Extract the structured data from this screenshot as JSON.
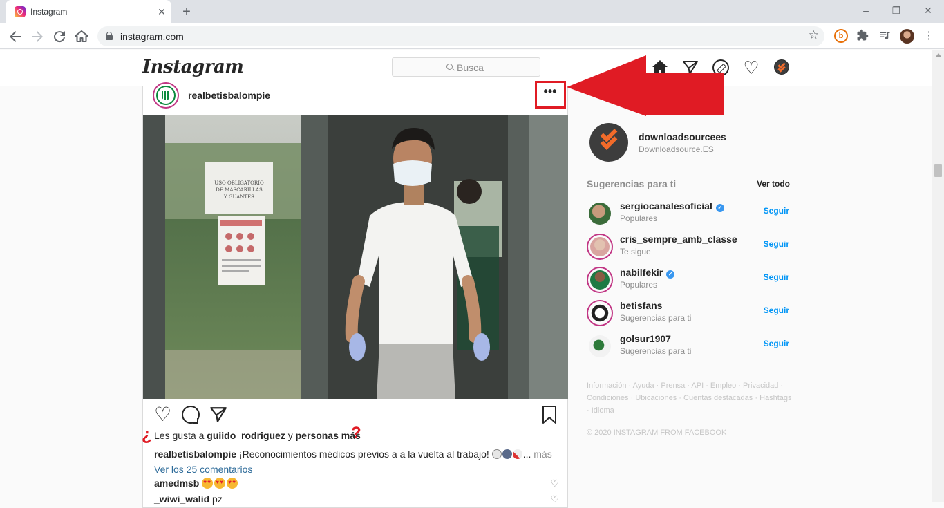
{
  "browser": {
    "tab_title": "Instagram",
    "tab_close": "✕",
    "new_tab": "+",
    "url": "instagram.com",
    "window_controls": [
      "–",
      "❐",
      "✕"
    ]
  },
  "header": {
    "logo": "Instagram",
    "search_placeholder": "Busca"
  },
  "post": {
    "username": "realbetisbalompie",
    "more": "•••",
    "image_sign_text": "USO OBLIGATORIO DE MASCARILLAS Y GUANTES",
    "likes_prefix": "Les gusta a ",
    "likes_user": "guiido_rodriguez",
    "likes_mid": " y ",
    "likes_others": "personas más",
    "question_open": "¿",
    "question_close": "?",
    "caption_user": "realbetisbalompie",
    "caption_text": " ¡Reconocimientos médicos previos a a la vuelta al trabajo! ",
    "caption_ellipsis": "... ",
    "caption_more": "más",
    "view_comments": "Ver los 25 comentarios",
    "comments": [
      {
        "user": "amedmsb",
        "text": ""
      },
      {
        "user": "_wiwi_walid",
        "text": " pz"
      }
    ]
  },
  "profile": {
    "username": "downloadsourcees",
    "name": "Downloadsource.ES"
  },
  "suggestions": {
    "title": "Sugerencias para ti",
    "see_all": "Ver todo",
    "follow_label": "Seguir",
    "items": [
      {
        "user": "sergiocanalesoficial",
        "sub": "Populares",
        "verified": true
      },
      {
        "user": "cris_sempre_amb_classe",
        "sub": "Te sigue",
        "verified": false
      },
      {
        "user": "nabilfekir",
        "sub": "Populares",
        "verified": true
      },
      {
        "user": "betisfans__",
        "sub": "Sugerencias para ti",
        "verified": false
      },
      {
        "user": "golsur1907",
        "sub": "Sugerencias para ti",
        "verified": false
      }
    ]
  },
  "footer": {
    "links": "Información · Ayuda · Prensa · API · Empleo · Privacidad · Condiciones · Ubicaciones · Cuentas destacadas · Hashtags · Idioma",
    "copyright": "© 2020 INSTAGRAM FROM FACEBOOK"
  },
  "colors": {
    "annotation_red": "#e01b24",
    "follow_blue": "#0095f6",
    "verified_blue": "#3897f0",
    "brand_orange": "#f26b2a"
  },
  "icons": {
    "header": [
      "home-icon",
      "paper-plane-icon",
      "compass-icon",
      "heart-icon",
      "avatar"
    ],
    "post_actions": [
      "heart-icon",
      "comment-icon",
      "share-icon",
      "bookmark-icon"
    ]
  }
}
